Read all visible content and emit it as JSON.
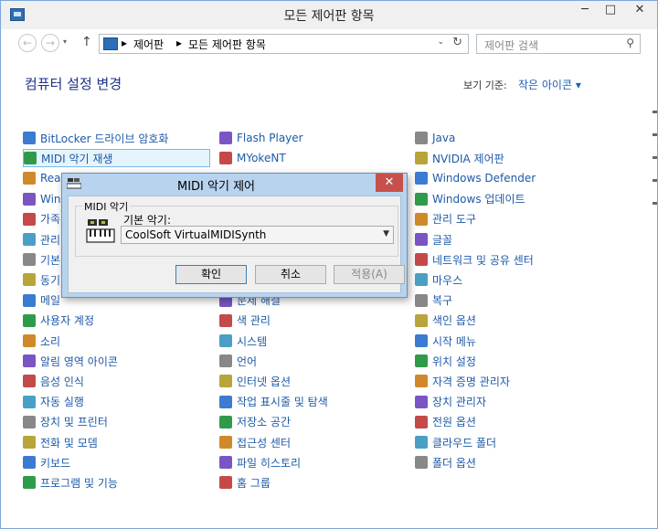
{
  "window": {
    "title": "모든 제어판 항목",
    "min_glyph": "─",
    "max_glyph": "□",
    "close_glyph": "✕"
  },
  "nav": {
    "back_glyph": "←",
    "forward_glyph": "→",
    "history_glyph": "▾",
    "up_glyph": "↑",
    "breadcrumb": [
      "제어판",
      "모든 제어판 항목"
    ],
    "separator": "▸",
    "dropdown_glyph": "⌄",
    "refresh_glyph": "↻",
    "search_placeholder": "제어판 검색",
    "search_glyph": "⚲"
  },
  "header": {
    "title": "컴퓨터 설정 변경",
    "view_by_label": "보기 기준:",
    "view_by_value": "작은 아이콘 ▾"
  },
  "items": {
    "col1": [
      "BitLocker 드라이브 암호화",
      "MIDI 악기 재생",
      "Real",
      "Wind",
      "가족",
      "관리",
      "기본",
      "동기",
      "메일",
      "사용자 계정",
      "소리",
      "알림 영역 아이콘",
      "음성 인식",
      "자동 실행",
      "장치 및 프린터",
      "전화 및 모뎀",
      "키보드",
      "프로그램 및 기능"
    ],
    "col2": [
      "Flash Player",
      "MYokeNT",
      "",
      "",
      "",
      "",
      "",
      "",
      "문제 해결",
      "색 관리",
      "시스템",
      "언어",
      "인터넷 옵션",
      "작업 표시줄 및 탐색",
      "저장소 공간",
      "접근성 센터",
      "파일 히스토리",
      "홈 그룹"
    ],
    "col3": [
      "Java",
      "NVIDIA 제어판",
      "Windows Defender",
      "Windows 업데이트",
      "관리 도구",
      "글꼴",
      "네트워크 및 공유 센터",
      "마우스",
      "복구",
      "색인 옵션",
      "시작 메뉴",
      "위치 설정",
      "자격 증명 관리자",
      "장치 관리자",
      "전원 옵션",
      "클라우드 폴더",
      "폴더 옵션",
      ""
    ]
  },
  "icons": {
    "col1": [
      "bitlocker-icon",
      "midi-icon",
      "realtek-icon",
      "windows-icon",
      "family-icon",
      "flag-icon",
      "default-programs-icon",
      "sync-icon",
      "mail-icon",
      "users-icon",
      "speaker-icon",
      "notification-icon",
      "microphone-icon",
      "autoplay-icon",
      "printer-icon",
      "phone-icon",
      "keyboard-icon",
      "programs-icon"
    ],
    "col2": [
      "flash-icon",
      "myokent-icon",
      "",
      "",
      "",
      "",
      "",
      "",
      "troubleshoot-icon",
      "color-management-icon",
      "system-icon",
      "language-icon",
      "internet-options-icon",
      "taskbar-icon",
      "storage-icon",
      "accessibility-icon",
      "file-history-icon",
      "homegroup-icon"
    ],
    "col3": [
      "java-icon",
      "nvidia-icon",
      "defender-icon",
      "windows-update-icon",
      "admin-tools-icon",
      "fonts-icon",
      "network-icon",
      "mouse-icon",
      "recovery-icon",
      "indexing-icon",
      "start-menu-icon",
      "location-icon",
      "credential-icon",
      "device-manager-icon",
      "power-icon",
      "cloud-folder-icon",
      "folder-options-icon",
      ""
    ]
  },
  "colors": {
    "accent": "#1e5aa8",
    "heading": "#1e3287",
    "selection": "#e5f3fb",
    "dialog_frame": "#b8d3ee",
    "close_red": "#c7504a"
  },
  "dialog": {
    "title": "MIDI 악기 제어",
    "close_glyph": "✕",
    "group_label": "MIDI 악기",
    "device_label": "기본 악기:",
    "device_value": "CoolSoft VirtualMIDISynth",
    "dropdown_glyph": "▼",
    "ok": "확인",
    "cancel": "취소",
    "apply": "적용(A)"
  }
}
